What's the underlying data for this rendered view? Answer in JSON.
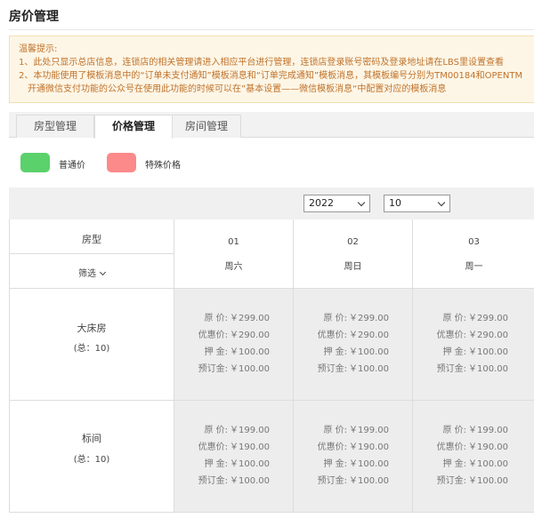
{
  "page": {
    "title": "房价管理"
  },
  "notice": {
    "heading": "温馨提示:",
    "lines": [
      "1、此处只显示总店信息，连锁店的相关管理请进入相应平台进行管理，连锁店登录账号密码及登录地址请在LBS里设置查看",
      "2、本功能使用了模板消息中的“订单未支付通知”模板消息和“订单完成通知”模板消息，其模板编号分别为TM00184和OPENTM",
      "开通微信支付功能的公众号在使用此功能的时候可以在”基本设置——微信模板消息“中配置对应的模板消息"
    ]
  },
  "tabs": [
    {
      "label": "房型管理",
      "active": false
    },
    {
      "label": "价格管理",
      "active": true
    },
    {
      "label": "房间管理",
      "active": false
    }
  ],
  "legend": [
    {
      "label": "普通价",
      "color": "#5bd16b"
    },
    {
      "label": "特殊价格",
      "color": "#fc8a8a"
    }
  ],
  "selects": {
    "year": "2022",
    "month": "10"
  },
  "table": {
    "room_header": "房型",
    "filter_label": "筛选",
    "dates": [
      {
        "day": "01",
        "week": "周六"
      },
      {
        "day": "02",
        "week": "周日"
      },
      {
        "day": "03",
        "week": "周一"
      }
    ],
    "price_labels": {
      "original": "原  价:",
      "discount": "优惠价:",
      "deposit": "押  金:",
      "booking": "预订金:"
    },
    "rooms": [
      {
        "name": "大床房",
        "total": "(总：10)",
        "prices": {
          "original": "￥299.00",
          "discount": "￥290.00",
          "deposit": "￥100.00",
          "booking": "￥100.00"
        }
      },
      {
        "name": "标间",
        "total": "(总：10)",
        "prices": {
          "original": "￥199.00",
          "discount": "￥190.00",
          "deposit": "￥100.00",
          "booking": "￥100.00"
        }
      }
    ]
  }
}
